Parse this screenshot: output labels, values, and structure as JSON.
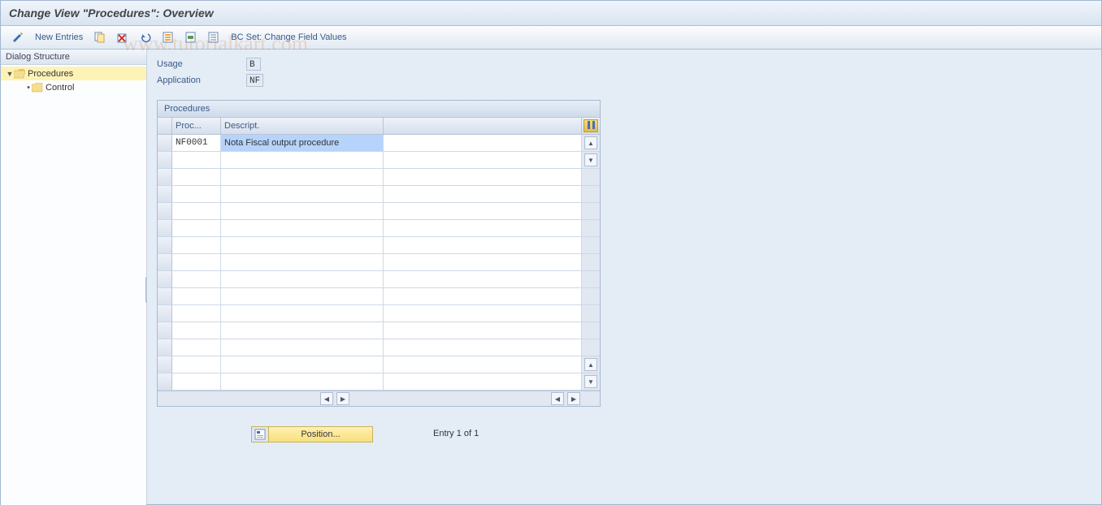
{
  "title": "Change View \"Procedures\": Overview",
  "toolbar": {
    "new_entries": "New Entries",
    "bcset": "BC Set: Change Field Values"
  },
  "sidebar": {
    "header": "Dialog Structure",
    "items": [
      {
        "label": "Procedures",
        "open": true,
        "selected": true
      },
      {
        "label": "Control"
      }
    ]
  },
  "fields": {
    "usage_label": "Usage",
    "usage_value": "B",
    "application_label": "Application",
    "application_value": "NF"
  },
  "panel": {
    "title": "Procedures",
    "columns": {
      "proc": "Proc...",
      "descript": "Descript."
    },
    "rows": [
      {
        "proc": "NF0001",
        "descript": "Nota Fiscal output procedure"
      }
    ],
    "empty_rows": 14
  },
  "footer": {
    "position_label": "Position...",
    "entry_text": "Entry 1 of 1"
  },
  "watermark": "www.tutorialkart.com"
}
